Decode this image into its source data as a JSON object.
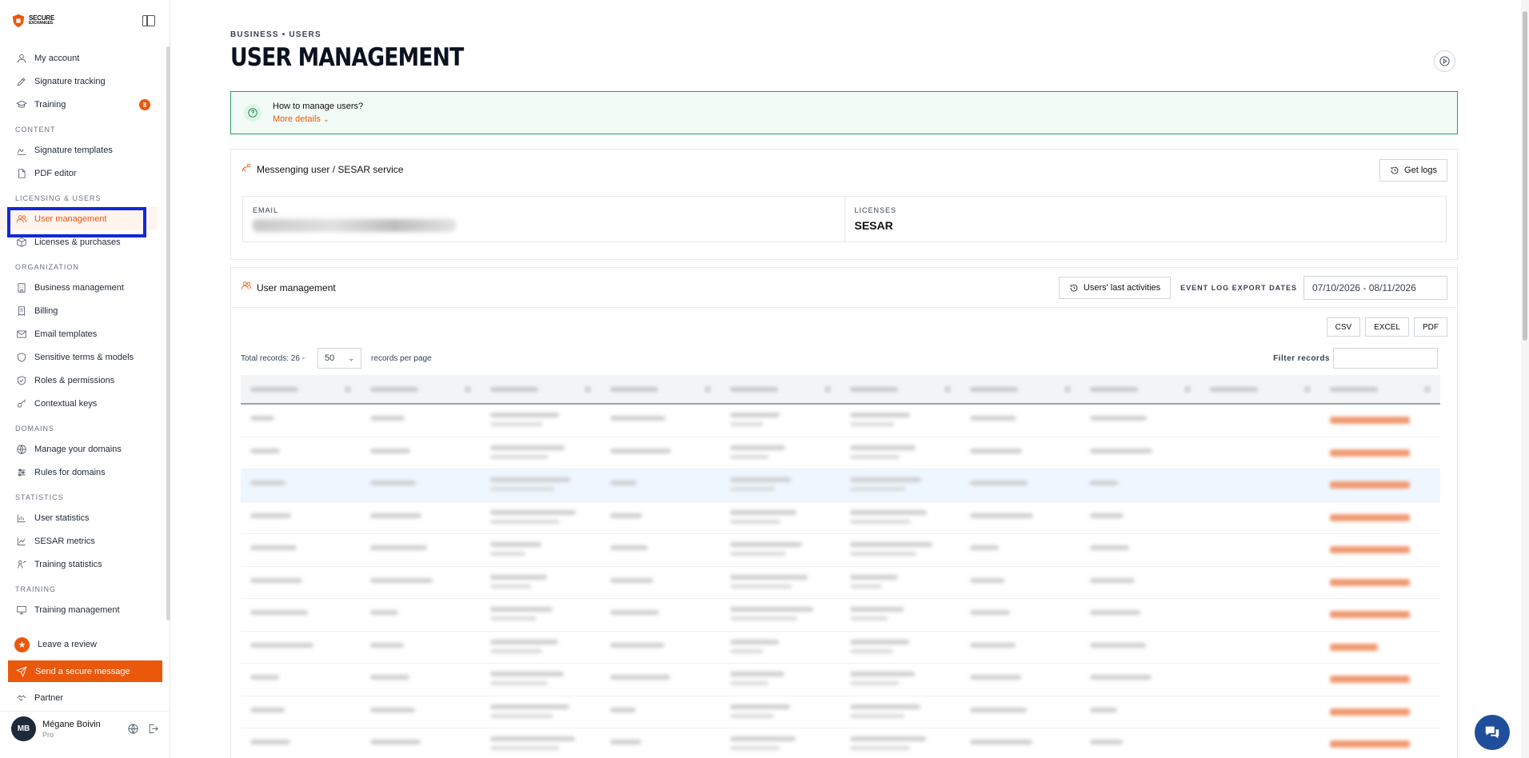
{
  "app": {
    "logo_line1": "SECURE",
    "logo_line2": "EXCHANGES",
    "brand_color": "#ea580c"
  },
  "sidebar": {
    "items_top": [
      {
        "label": "My account",
        "icon": "user-icon"
      },
      {
        "label": "Signature tracking",
        "icon": "pen-icon"
      },
      {
        "label": "Training",
        "icon": "graduation-cap-icon",
        "badge": "8"
      }
    ],
    "sections": [
      {
        "title": "CONTENT",
        "items": [
          {
            "label": "Signature templates",
            "icon": "signature-icon"
          },
          {
            "label": "PDF editor",
            "icon": "file-edit-icon"
          }
        ]
      },
      {
        "title": "LICENSING & USERS",
        "items": [
          {
            "label": "User management",
            "icon": "users-icon",
            "active": true
          },
          {
            "label": "Licenses & purchases",
            "icon": "box-icon"
          }
        ]
      },
      {
        "title": "ORGANIZATION",
        "items": [
          {
            "label": "Business management",
            "icon": "building-icon"
          },
          {
            "label": "Billing",
            "icon": "receipt-icon"
          },
          {
            "label": "Email templates",
            "icon": "mail-icon"
          },
          {
            "label": "Sensitive terms & models",
            "icon": "shield-icon"
          },
          {
            "label": "Roles & permissions",
            "icon": "shield-check-icon"
          },
          {
            "label": "Contextual keys",
            "icon": "key-icon"
          }
        ]
      },
      {
        "title": "DOMAINS",
        "items": [
          {
            "label": "Manage your domains",
            "icon": "globe-icon"
          },
          {
            "label": "Rules for domains",
            "icon": "sliders-icon"
          }
        ]
      },
      {
        "title": "STATISTICS",
        "items": [
          {
            "label": "User statistics",
            "icon": "bar-chart-icon"
          },
          {
            "label": "SESAR metrics",
            "icon": "line-chart-icon"
          },
          {
            "label": "Training statistics",
            "icon": "training-stats-icon"
          }
        ]
      },
      {
        "title": "TRAINING",
        "items": [
          {
            "label": "Training management",
            "icon": "presentation-icon"
          }
        ]
      }
    ],
    "leave_review": "Leave a review",
    "send_message": "Send a secure message",
    "partner": "Partner",
    "user": {
      "initials": "MB",
      "name": "Mégane Boivin",
      "plan": "Pro"
    }
  },
  "main": {
    "breadcrumb": "BUSINESS • USERS",
    "title": "USER MANAGEMENT",
    "help": {
      "title": "How to manage users?",
      "more": "More details"
    },
    "service_card": {
      "title": "Messenging user / SESAR service",
      "get_logs": "Get logs",
      "email_label": "EMAIL",
      "licenses_label": "LICENSES",
      "licenses_value": "SESAR"
    },
    "users_card": {
      "title": "User management",
      "last_activities": "Users' last activities",
      "event_label": "EVENT LOG EXPORT DATES",
      "date_range": "07/10/2026 - 08/11/2026",
      "exports": [
        "CSV",
        "EXCEL",
        "PDF"
      ],
      "total_records": "Total records: 26 -",
      "per_page_value": "50",
      "per_page_label": "records per page",
      "filter_label": "Filter records",
      "columns": 10,
      "rows": 11
    }
  }
}
